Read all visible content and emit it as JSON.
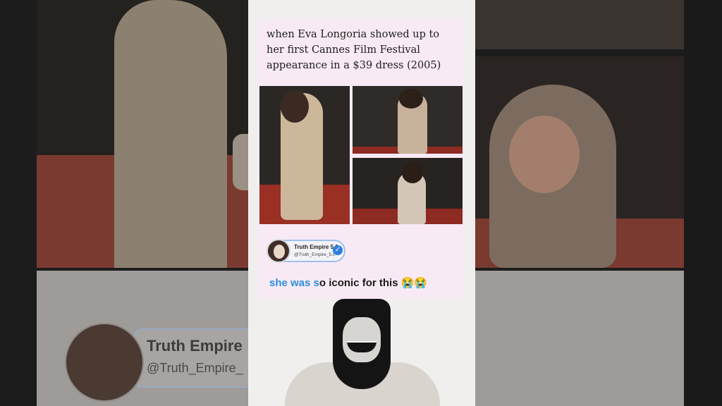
{
  "background": {
    "left_badge": {
      "name": "Truth Empire",
      "handle": "@Truth_Empire_"
    }
  },
  "post": {
    "title": "when Eva Longoria showed up to her first Cannes Film Festival appearance in a $39 dress (2005)",
    "images": [
      {
        "icon": "red-carpet-photo"
      },
      {
        "icon": "red-carpet-photo"
      },
      {
        "icon": "red-carpet-photo"
      }
    ],
    "account": {
      "name": "Truth Empire 5.0",
      "handle": "@Truth_Empire_5.0",
      "verified_icon": "verified-check-icon"
    },
    "caption": {
      "highlight_1": "she was s",
      "rest": "o iconic for this",
      "emoji": "😭😭"
    }
  },
  "colors": {
    "card_bg": "#f8eaf4",
    "highlight_text": "#2b8fdf",
    "verified": "#2f7fe0"
  }
}
